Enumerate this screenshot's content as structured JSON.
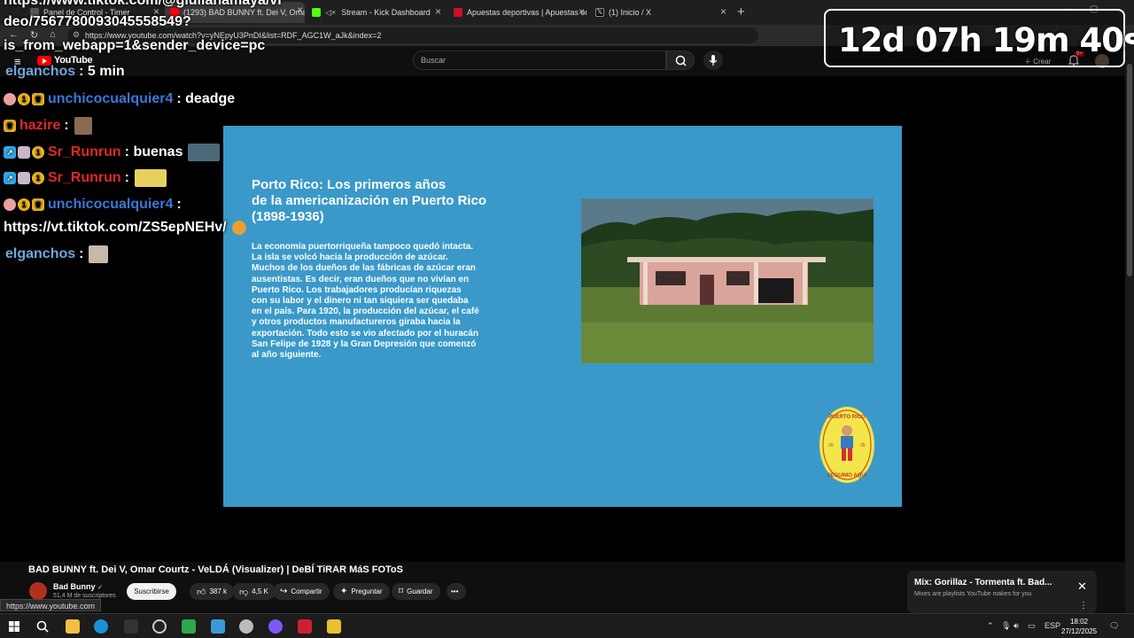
{
  "browser": {
    "tabs": [
      {
        "label": "Panel de Control - Timer",
        "active": false
      },
      {
        "label": "(1293) BAD BUNNY ft. Dei V, Omar",
        "active": true
      },
      {
        "label": "Stream - Kick Dashboard",
        "active": false
      },
      {
        "label": "Apuestas deportivas | Apuestas on",
        "active": false
      },
      {
        "label": "(1) Inicio / X",
        "active": false
      }
    ],
    "url": "https://www.youtube.com/watch?v=yNEpyU3PnDI&list=RDF_AGC1W_aJk&index=2",
    "status_url": "https://www.youtube.com"
  },
  "youtube": {
    "logo_text": "YouTube",
    "search_placeholder": "Buscar",
    "create_label": "Crear",
    "notif_count": "9+"
  },
  "chat": {
    "top_link": [
      "https://www.tiktok.com/@giulianamaya/vi",
      "deo/7567780093045558549?",
      "is_from_webapp=1&sender_device=pc"
    ],
    "messages": [
      {
        "user": "elganchos",
        "color": "#6fa8dc",
        "text": ": 5 min"
      },
      {
        "user": "unchicocualquier4",
        "color": "#3a78d8",
        "text": ": deadge"
      },
      {
        "user": "hazire",
        "color": "#e02828",
        "text": ":"
      },
      {
        "user": "Sr_Runrun",
        "color": "#e02828",
        "text": ": buenas"
      },
      {
        "user": "Sr_Runrun",
        "color": "#e02828",
        "text": ":"
      },
      {
        "user": "unchicocualquier4",
        "color": "#3a78d8",
        "text": ":"
      },
      {
        "user": "elganchos",
        "color": "#6fa8dc",
        "text": ":"
      }
    ],
    "link_message": "https://vt.tiktok.com/ZS5epNEHv/"
  },
  "timer": {
    "text": "12d 07h 19m 40s"
  },
  "slide": {
    "title": "Porto Rico: Los primeros años\nde la americanización en Puerto Rico\n(1898-1936)",
    "body": "La economía puertorriqueña tampoco quedó intacta.\nLa isla se volcó hacia la producción de azúcar.\nMuchos de los dueños de las fábricas de azúcar eran\nausentistas. Es decir, eran dueños que no vivían en\nPuerto Rico. Los trabajadores producían riquezas\ncon su labor y el dinero ni tan siquiera ser quedaba\nen el país. Para 1920, la producción del azúcar, el café\ny otros productos manufactureros giraba hacia la\nexportación. Todo esto se vio afectado por el huracán\nSan Felipe de 1928 y la Gran Depresión que comenzó\nal año siguiente.",
    "seal_top": "PUERTO RICO",
    "seal_bottom": "SEGUIMO AQUÍ",
    "seal_year_left": "20",
    "seal_year_right": "25"
  },
  "video": {
    "title": "BAD BUNNY ft. Dei V, Omar Courtz - VeLDÁ (Visualizer) | DeBÍ TiRAR MáS FOToS",
    "channel": "Bad Bunny",
    "subscribers": "51,4 M de suscriptores",
    "subscribe_label": "Suscribirse",
    "likes": "387 k",
    "dislikes": "4,5 K",
    "share_label": "Compartir",
    "ask_label": "Preguntar",
    "save_label": "Guardar"
  },
  "mix": {
    "title": "Mix: Gorillaz - Tormenta ft. Bad...",
    "subtitle": "Mixes are playlists YouTube makes for you"
  },
  "taskbar": {
    "lang": "ESP",
    "time": "18:02",
    "date": "27/12/2025"
  }
}
